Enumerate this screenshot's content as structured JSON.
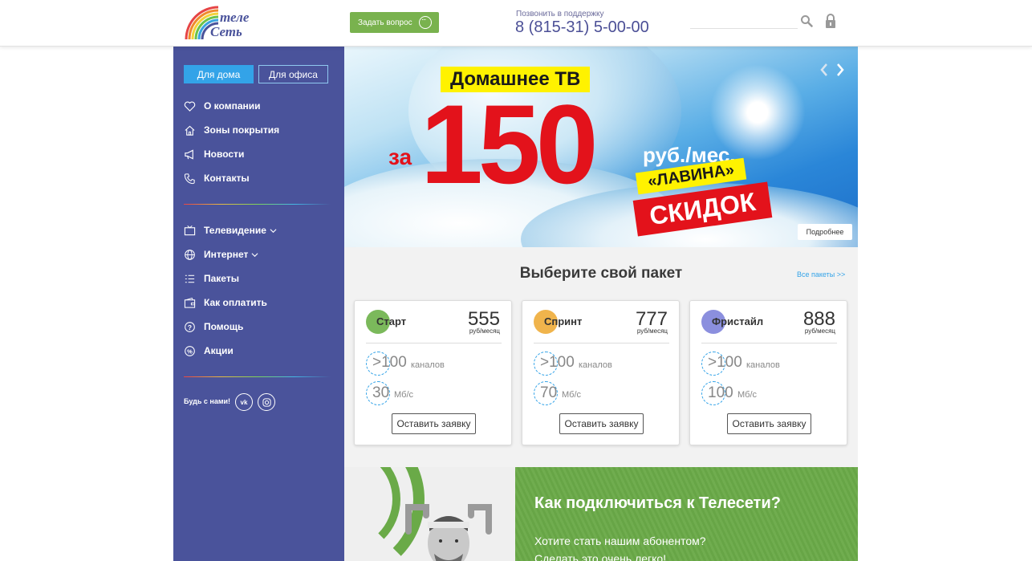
{
  "header": {
    "logo_text_top": "теле",
    "logo_text_bottom": "Сеть",
    "ask_button": "Задать вопрос",
    "support_label": "Позвонить в поддержку",
    "support_phone": "8 (815-31) 5-00-00",
    "search_placeholder": ""
  },
  "sidebar": {
    "tab_home": "Для дома",
    "tab_office": "Для офиса",
    "menu_top": [
      {
        "label": "О компании",
        "icon": "heart-icon"
      },
      {
        "label": "Зоны покрытия",
        "icon": "home-icon"
      },
      {
        "label": "Новости",
        "icon": "megaphone-icon"
      },
      {
        "label": "Контакты",
        "icon": "phone-icon"
      }
    ],
    "menu_bottom": [
      {
        "label": "Телевидение",
        "icon": "tv-icon",
        "has_dropdown": true
      },
      {
        "label": "Интернет",
        "icon": "globe-icon",
        "has_dropdown": true
      },
      {
        "label": "Пакеты",
        "icon": "list-icon"
      },
      {
        "label": "Как оплатить",
        "icon": "wallet-icon"
      },
      {
        "label": "Помощь",
        "icon": "question-icon"
      },
      {
        "label": "Акции",
        "icon": "percent-icon"
      }
    ],
    "social_label": "Будь с нами!",
    "social": [
      {
        "label": "vk",
        "icon": "vk-icon"
      },
      {
        "label": "",
        "icon": "instagram-icon"
      }
    ]
  },
  "banner": {
    "title": "Домашнее ТВ",
    "za": "за",
    "price": "150",
    "unit": "руб./мес.",
    "lavina": "«ЛАВИНА»",
    "skidok": "СКИДОК",
    "more_button": "Подробнее"
  },
  "packages": {
    "title": "Выберите свой пакет",
    "all_link": "Все пакеты >>",
    "items": [
      {
        "name": "Старт",
        "price": "555",
        "per": "руб/месяц",
        "channels": ">100",
        "channels_unit": "каналов",
        "speed": "30",
        "speed_unit": "Мб/с",
        "button": "Оставить заявку",
        "color": "#7bb95b"
      },
      {
        "name": "Спринт",
        "price": "777",
        "per": "руб/месяц",
        "channels": ">100",
        "channels_unit": "каналов",
        "speed": "70",
        "speed_unit": "Мб/с",
        "button": "Оставить заявку",
        "color": "#f0b44c"
      },
      {
        "name": "Фристайл",
        "price": "888",
        "per": "руб/месяц",
        "channels": ">100",
        "channels_unit": "каналов",
        "speed": "100",
        "speed_unit": "Мб/с",
        "button": "Оставить заявку",
        "color": "#8b8fde"
      }
    ]
  },
  "connect": {
    "title": "Как подключиться к Телесети?",
    "line1": "Хотите стать нашим абонентом?",
    "line2": "Сделать это очень легко!"
  },
  "colors": {
    "sidebar_bg": "#4a539b",
    "accent_blue": "#33a3e8",
    "green": "#79b24e",
    "banner_red": "#e3121b",
    "banner_yellow": "#fff200"
  }
}
